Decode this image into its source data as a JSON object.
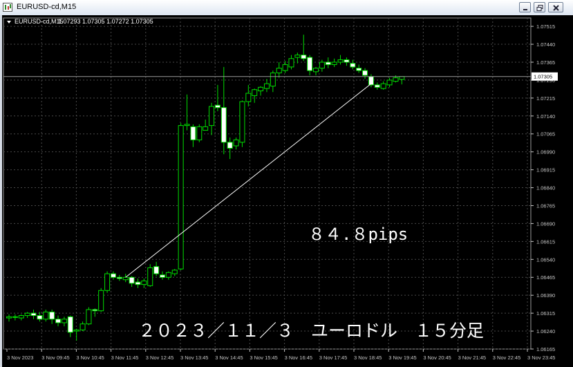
{
  "window": {
    "title": "EURUSD-cd,M15"
  },
  "info": {
    "symbol": "EURUSD-cd,M15",
    "ohlc": "1.07293 1.07305 1.07272 1.07305"
  },
  "annotations": {
    "pips": "８４.８pips",
    "caption": "２０２３／１１／３　ユーロドル　１５分足"
  },
  "colors": {
    "background": "#000000",
    "grid": "#4a4a4a",
    "bull": "#00e000",
    "bear_body": "#ffffff",
    "axis": "#c8c8c8",
    "price_marker": "#ffffff"
  },
  "chart_data": {
    "type": "candlestick",
    "timeframe": "M15",
    "ylim": [
      1.06165,
      1.0755
    ],
    "y_ticks": [
      "1.07515",
      "1.07440",
      "1.07365",
      "1.07290",
      "1.07215",
      "1.07140",
      "1.07065",
      "1.06990",
      "1.06915",
      "1.06840",
      "1.06765",
      "1.06690",
      "1.06615",
      "1.06540",
      "1.06465",
      "1.06390",
      "1.06315",
      "1.06240",
      "1.06165"
    ],
    "x_ticks": [
      "3 Nov 2023",
      "3 Nov 09:45",
      "3 Nov 10:45",
      "3 Nov 11:45",
      "3 Nov 12:45",
      "3 Nov 13:45",
      "3 Nov 14:45",
      "3 Nov 15:45",
      "3 Nov 16:45",
      "3 Nov 17:45",
      "3 Nov 18:45",
      "3 Nov 19:45",
      "3 Nov 20:45",
      "3 Nov 21:45",
      "3 Nov 22:45",
      "3 Nov 23:45"
    ],
    "current_price": "1.07305",
    "grid": true,
    "candles": [
      {
        "o": 1.06295,
        "h": 1.0631,
        "l": 1.0628,
        "c": 1.063
      },
      {
        "o": 1.063,
        "h": 1.0631,
        "l": 1.06285,
        "c": 1.063
      },
      {
        "o": 1.06295,
        "h": 1.0631,
        "l": 1.06285,
        "c": 1.06305
      },
      {
        "o": 1.06305,
        "h": 1.0632,
        "l": 1.06295,
        "c": 1.06315
      },
      {
        "o": 1.06315,
        "h": 1.0633,
        "l": 1.0629,
        "c": 1.06305
      },
      {
        "o": 1.06305,
        "h": 1.0632,
        "l": 1.0628,
        "c": 1.0629
      },
      {
        "o": 1.0629,
        "h": 1.0633,
        "l": 1.0628,
        "c": 1.0632
      },
      {
        "o": 1.0632,
        "h": 1.0633,
        "l": 1.0627,
        "c": 1.0629
      },
      {
        "o": 1.0629,
        "h": 1.06305,
        "l": 1.0626,
        "c": 1.06275
      },
      {
        "o": 1.06275,
        "h": 1.063,
        "l": 1.0626,
        "c": 1.0629
      },
      {
        "o": 1.063,
        "h": 1.06305,
        "l": 1.06215,
        "c": 1.06235
      },
      {
        "o": 1.0624,
        "h": 1.0625,
        "l": 1.062,
        "c": 1.06245
      },
      {
        "o": 1.06245,
        "h": 1.0628,
        "l": 1.0624,
        "c": 1.0627
      },
      {
        "o": 1.0627,
        "h": 1.0634,
        "l": 1.06265,
        "c": 1.0633
      },
      {
        "o": 1.0633,
        "h": 1.06335,
        "l": 1.063,
        "c": 1.06325
      },
      {
        "o": 1.06325,
        "h": 1.0642,
        "l": 1.0632,
        "c": 1.0641
      },
      {
        "o": 1.0641,
        "h": 1.0649,
        "l": 1.064,
        "c": 1.0648
      },
      {
        "o": 1.0648,
        "h": 1.0649,
        "l": 1.06455,
        "c": 1.06465
      },
      {
        "o": 1.06465,
        "h": 1.06475,
        "l": 1.0645,
        "c": 1.0646
      },
      {
        "o": 1.06455,
        "h": 1.0648,
        "l": 1.06445,
        "c": 1.06465
      },
      {
        "o": 1.06465,
        "h": 1.0647,
        "l": 1.06425,
        "c": 1.0644
      },
      {
        "o": 1.06445,
        "h": 1.0646,
        "l": 1.0642,
        "c": 1.06435
      },
      {
        "o": 1.06435,
        "h": 1.0646,
        "l": 1.0642,
        "c": 1.0645
      },
      {
        "o": 1.0643,
        "h": 1.0652,
        "l": 1.06425,
        "c": 1.06505
      },
      {
        "o": 1.0651,
        "h": 1.0653,
        "l": 1.0647,
        "c": 1.0648
      },
      {
        "o": 1.06475,
        "h": 1.0649,
        "l": 1.06455,
        "c": 1.06465
      },
      {
        "o": 1.06465,
        "h": 1.0649,
        "l": 1.06455,
        "c": 1.06485
      },
      {
        "o": 1.0648,
        "h": 1.065,
        "l": 1.0647,
        "c": 1.06495
      },
      {
        "o": 1.065,
        "h": 1.0711,
        "l": 1.06495,
        "c": 1.071
      },
      {
        "o": 1.071,
        "h": 1.0723,
        "l": 1.0708,
        "c": 1.07105
      },
      {
        "o": 1.07095,
        "h": 1.07105,
        "l": 1.0701,
        "c": 1.0704
      },
      {
        "o": 1.0704,
        "h": 1.07105,
        "l": 1.0703,
        "c": 1.07095
      },
      {
        "o": 1.0708,
        "h": 1.07125,
        "l": 1.0708,
        "c": 1.07095
      },
      {
        "o": 1.071,
        "h": 1.07195,
        "l": 1.0706,
        "c": 1.0718
      },
      {
        "o": 1.07185,
        "h": 1.0727,
        "l": 1.0716,
        "c": 1.07175
      },
      {
        "o": 1.07175,
        "h": 1.07345,
        "l": 1.0698,
        "c": 1.0703
      },
      {
        "o": 1.0703,
        "h": 1.0705,
        "l": 1.0696,
        "c": 1.07005
      },
      {
        "o": 1.07015,
        "h": 1.0705,
        "l": 1.07,
        "c": 1.0704
      },
      {
        "o": 1.0703,
        "h": 1.07205,
        "l": 1.0701,
        "c": 1.072
      },
      {
        "o": 1.072,
        "h": 1.0727,
        "l": 1.0718,
        "c": 1.07235
      },
      {
        "o": 1.07225,
        "h": 1.07255,
        "l": 1.07195,
        "c": 1.0725
      },
      {
        "o": 1.07245,
        "h": 1.07265,
        "l": 1.07225,
        "c": 1.0726
      },
      {
        "o": 1.07255,
        "h": 1.07295,
        "l": 1.0724,
        "c": 1.07275
      },
      {
        "o": 1.07265,
        "h": 1.0733,
        "l": 1.0724,
        "c": 1.0732
      },
      {
        "o": 1.0732,
        "h": 1.07365,
        "l": 1.073,
        "c": 1.0734
      },
      {
        "o": 1.0733,
        "h": 1.0737,
        "l": 1.0732,
        "c": 1.07355
      },
      {
        "o": 1.07345,
        "h": 1.07395,
        "l": 1.07335,
        "c": 1.0738
      },
      {
        "o": 1.07385,
        "h": 1.07405,
        "l": 1.0736,
        "c": 1.07395
      },
      {
        "o": 1.07395,
        "h": 1.0748,
        "l": 1.0737,
        "c": 1.0738
      },
      {
        "o": 1.07385,
        "h": 1.07395,
        "l": 1.0731,
        "c": 1.0733
      },
      {
        "o": 1.07325,
        "h": 1.07345,
        "l": 1.0731,
        "c": 1.0734
      },
      {
        "o": 1.0734,
        "h": 1.07375,
        "l": 1.07325,
        "c": 1.07365
      },
      {
        "o": 1.07365,
        "h": 1.07385,
        "l": 1.0734,
        "c": 1.07355
      },
      {
        "o": 1.07355,
        "h": 1.0738,
        "l": 1.07345,
        "c": 1.07365
      },
      {
        "o": 1.07365,
        "h": 1.07395,
        "l": 1.07355,
        "c": 1.07375
      },
      {
        "o": 1.07375,
        "h": 1.07385,
        "l": 1.0735,
        "c": 1.07365
      },
      {
        "o": 1.0736,
        "h": 1.07375,
        "l": 1.07335,
        "c": 1.07345
      },
      {
        "o": 1.0734,
        "h": 1.07355,
        "l": 1.0732,
        "c": 1.0733
      },
      {
        "o": 1.0733,
        "h": 1.0734,
        "l": 1.07295,
        "c": 1.0731
      },
      {
        "o": 1.07305,
        "h": 1.07315,
        "l": 1.0726,
        "c": 1.0727
      },
      {
        "o": 1.0727,
        "h": 1.0728,
        "l": 1.0725,
        "c": 1.0726
      },
      {
        "o": 1.07255,
        "h": 1.07285,
        "l": 1.0725,
        "c": 1.07275
      },
      {
        "o": 1.0727,
        "h": 1.073,
        "l": 1.0726,
        "c": 1.0729
      },
      {
        "o": 1.07285,
        "h": 1.0731,
        "l": 1.0728,
        "c": 1.073
      },
      {
        "o": 1.07293,
        "h": 1.07305,
        "l": 1.07272,
        "c": 1.07305
      }
    ],
    "trend_line": {
      "from_candle": 19,
      "from_price": 1.06465,
      "to_candle": 59,
      "to_price": 1.07275
    }
  }
}
